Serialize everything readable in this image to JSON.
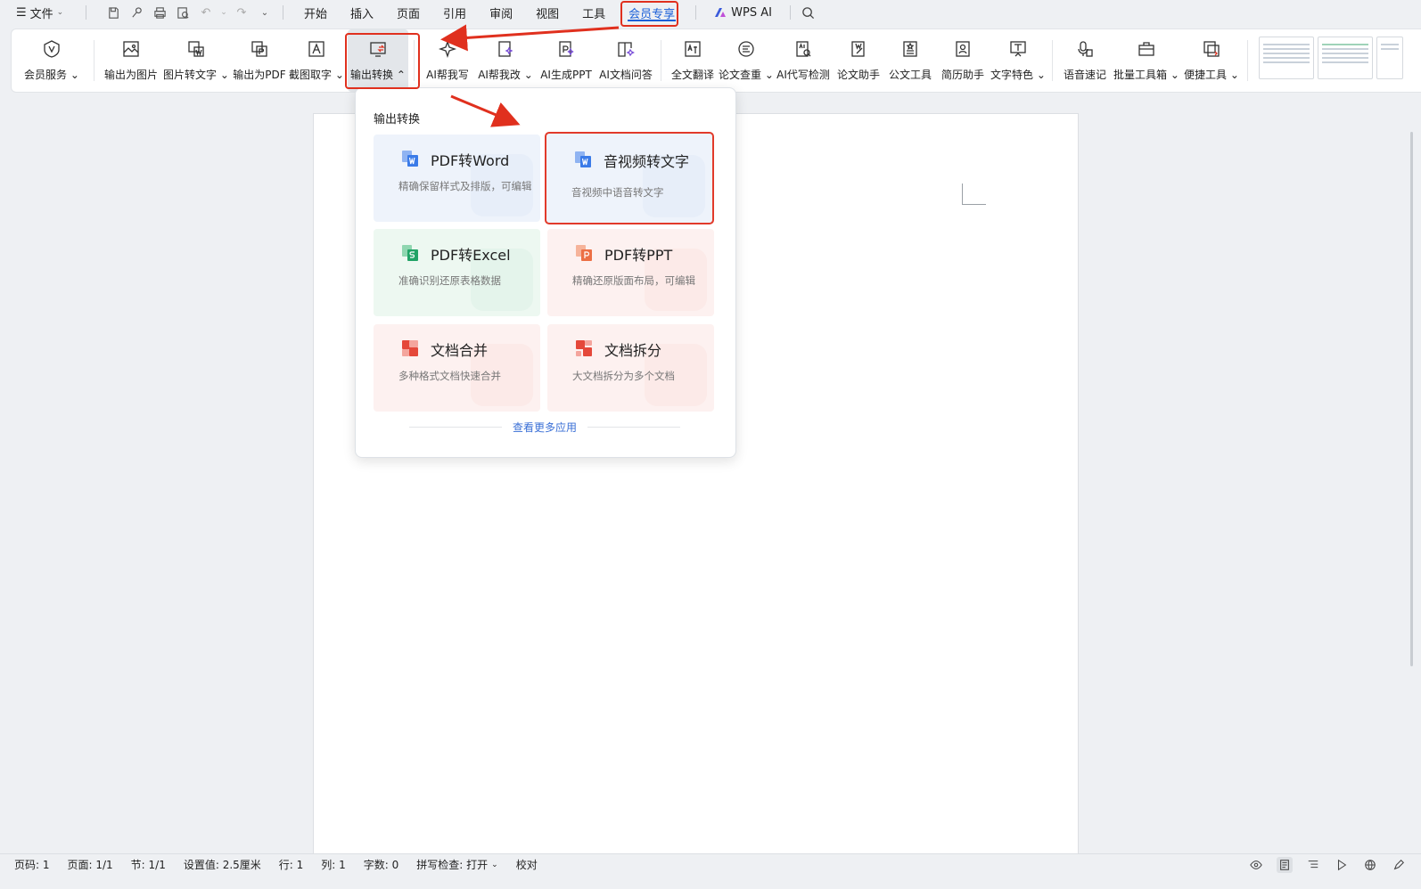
{
  "menubar": {
    "file_label": "文件",
    "tabs": [
      {
        "label": "开始"
      },
      {
        "label": "插入"
      },
      {
        "label": "页面"
      },
      {
        "label": "引用"
      },
      {
        "label": "审阅"
      },
      {
        "label": "视图"
      },
      {
        "label": "工具"
      },
      {
        "label": "会员专享",
        "active": true
      }
    ],
    "ai_label": "WPS AI",
    "accent_color": "#1a5fd8"
  },
  "ribbon": {
    "buttons": [
      {
        "label": "会员服务",
        "icon": "vip-icon",
        "dropdown": true
      },
      {
        "label": "输出为图片",
        "icon": "export-image-icon"
      },
      {
        "label": "图片转文字",
        "icon": "image-to-text-icon",
        "dropdown": true
      },
      {
        "label": "输出为PDF",
        "icon": "export-pdf-icon"
      },
      {
        "label": "截图取字",
        "icon": "screenshot-text-icon",
        "dropdown": true
      },
      {
        "label": "输出转换",
        "icon": "output-convert-icon",
        "dropdown": true,
        "pressed": true
      },
      {
        "label": "AI帮我写",
        "icon": "ai-write-icon"
      },
      {
        "label": "AI帮我改",
        "icon": "ai-edit-icon",
        "dropdown": true
      },
      {
        "label": "AI生成PPT",
        "icon": "ai-ppt-icon"
      },
      {
        "label": "AI文档问答",
        "icon": "ai-qa-icon"
      },
      {
        "label": "全文翻译",
        "icon": "translate-icon"
      },
      {
        "label": "论文查重",
        "icon": "paper-check-icon",
        "dropdown": true
      },
      {
        "label": "AI代写检测",
        "icon": "ai-detect-icon"
      },
      {
        "label": "论文助手",
        "icon": "paper-assistant-icon"
      },
      {
        "label": "公文工具",
        "icon": "official-doc-icon"
      },
      {
        "label": "简历助手",
        "icon": "resume-icon"
      },
      {
        "label": "文字特色",
        "icon": "text-feature-icon",
        "dropdown": true
      },
      {
        "label": "语音速记",
        "icon": "voice-note-icon"
      },
      {
        "label": "批量工具箱",
        "icon": "batch-toolbox-icon",
        "dropdown": true
      },
      {
        "label": "便捷工具",
        "icon": "handy-tools-icon",
        "dropdown": true
      }
    ]
  },
  "dropdown": {
    "title": "输出转换",
    "cards": [
      {
        "title": "PDF转Word",
        "desc": "精确保留样式及排版，可编辑",
        "theme": "blue",
        "icon": "pdf-to-word-icon",
        "icon_color": "#3b7be8"
      },
      {
        "title": "音视频转文字",
        "desc": "音视频中语音转文字",
        "theme": "blue",
        "icon": "audio-video-to-text-icon",
        "icon_color": "#3b7be8",
        "highlighted": true
      },
      {
        "title": "PDF转Excel",
        "desc": "准确识别还原表格数据",
        "theme": "green",
        "icon": "pdf-to-excel-icon",
        "icon_color": "#21a366"
      },
      {
        "title": "PDF转PPT",
        "desc": "精确还原版面布局，可编辑",
        "theme": "pink",
        "icon": "pdf-to-ppt-icon",
        "icon_color": "#ec6f45"
      },
      {
        "title": "文档合并",
        "desc": "多种格式文档快速合并",
        "theme": "pink",
        "icon": "doc-merge-icon",
        "icon_color": "#e5483a"
      },
      {
        "title": "文档拆分",
        "desc": "大文档拆分为多个文档",
        "theme": "pink",
        "icon": "doc-split-icon",
        "icon_color": "#e5483a"
      }
    ],
    "more_link": "查看更多应用"
  },
  "statusbar": {
    "page_code": "页码: 1",
    "page": "页面: 1/1",
    "section": "节: 1/1",
    "setting": "设置值: 2.5厘米",
    "row": "行: 1",
    "col": "列: 1",
    "word_count": "字数: 0",
    "spell_check": "拼写检查: 打开",
    "proofread": "校对"
  },
  "colors": {
    "annotation_red": "#e0301e",
    "link_blue": "#3a6fd6"
  }
}
